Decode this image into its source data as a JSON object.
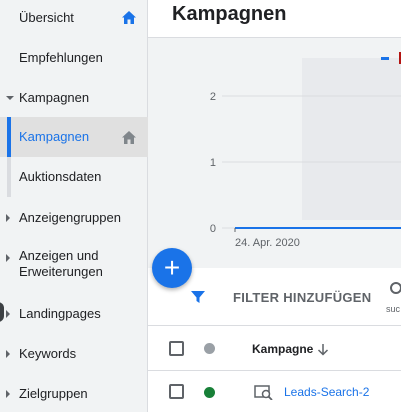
{
  "sidebar": {
    "items": [
      {
        "label": "Übersicht",
        "home": true
      },
      {
        "label": "Empfehlungen"
      },
      {
        "label": "Kampagnen",
        "expanded": true
      },
      {
        "label": "Kampagnen",
        "active": true,
        "home": true
      },
      {
        "label": "Auktionsdaten"
      },
      {
        "label": "Anzeigengruppen"
      },
      {
        "label_line1": "Anzeigen und",
        "label_line2": "Erweiterungen"
      },
      {
        "label": "Landingpages"
      },
      {
        "label": "Keywords"
      },
      {
        "label": "Zielgruppen"
      }
    ]
  },
  "header": {
    "title": "Kampagnen"
  },
  "chart_data": {
    "type": "line",
    "x": [
      "24. Apr. 2020"
    ],
    "series": [
      {
        "values": [
          0
        ],
        "color": "#1a73e8"
      }
    ],
    "y_ticks": [
      "2",
      "1",
      "0"
    ],
    "ylim": [
      0,
      2
    ],
    "legend": "top-right",
    "grid": true
  },
  "toolbar": {
    "filter_label": "FILTER HINZUFÜGEN",
    "partial_label": "suc"
  },
  "table": {
    "columns": [
      {
        "label": "Kampagne",
        "sort": "descending"
      }
    ],
    "rows": [
      {
        "name": "Leads-Search-2",
        "status_color": "#188038"
      }
    ]
  },
  "colors": {
    "accent": "#1a73e8",
    "status_header": "#9aa0a6"
  }
}
